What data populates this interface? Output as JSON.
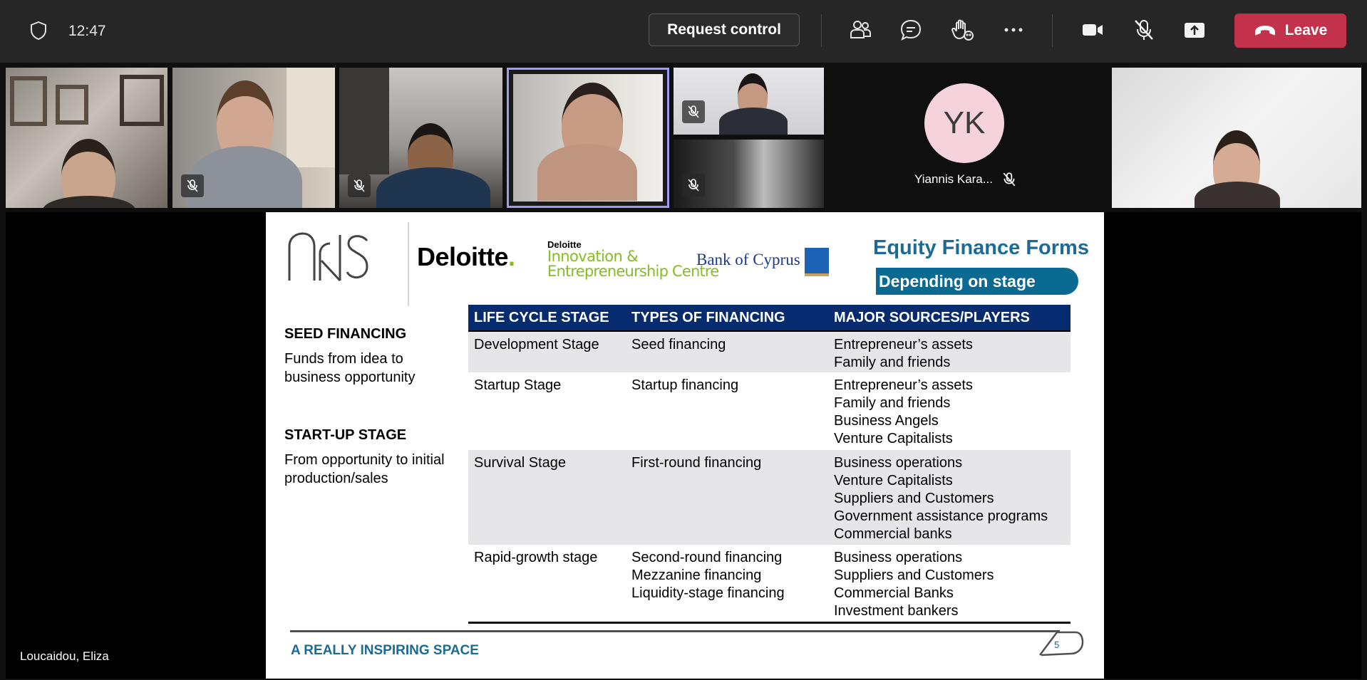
{
  "topbar": {
    "time": "12:47",
    "request_control_label": "Request control",
    "leave_label": "Leave",
    "icons": [
      "shield-icon",
      "people-icon",
      "chat-icon",
      "raise-hand-icon",
      "more-icon",
      "camera-icon",
      "mic-off-icon",
      "share-icon",
      "phone-hangup-icon"
    ]
  },
  "participants": {
    "yk_initials": "YK",
    "yk_name": "Yiannis Kara..."
  },
  "stage": {
    "presenter_name": "Loucaidou, Eliza"
  },
  "slide": {
    "logos": {
      "deloitte": "Deloitte",
      "deloitte_dot": ".",
      "dic_line1": "Deloitte",
      "dic_line2": "Innovation &",
      "dic_line3": "Entrepreneurship Centre",
      "bank": "Bank of Cyprus"
    },
    "title": "Equity Finance Forms",
    "subtitle": "Depending on stage",
    "left": {
      "seed_heading": "SEED FINANCING",
      "seed_text_1": "Funds from idea to",
      "seed_text_2": "business opportunity",
      "startup_heading": "START-UP STAGE",
      "startup_text_1": "From opportunity to initial",
      "startup_text_2": "production/sales"
    },
    "table": {
      "headers": [
        "LIFE CYCLE STAGE",
        "TYPES OF FINANCING",
        "MAJOR SOURCES/PLAYERS"
      ],
      "rows": [
        {
          "stage": "Development Stage",
          "financing": "Seed financing",
          "sources": "Entrepreneur’s assets\nFamily and friends"
        },
        {
          "stage": "Startup Stage",
          "financing": "Startup financing",
          "sources": "Entrepreneur’s assets\nFamily and friends\nBusiness Angels\nVenture Capitalists"
        },
        {
          "stage": "Survival Stage",
          "financing": "First-round financing",
          "sources": "Business operations\nVenture Capitalists\nSuppliers and Customers\nGovernment assistance programs\nCommercial banks"
        },
        {
          "stage": "Rapid-growth stage",
          "financing": "Second-round financing\nMezzanine financing\nLiquidity-stage financing",
          "sources": "Business operations\nSuppliers and Customers\nCommercial Banks\nInvestment bankers"
        }
      ]
    },
    "footer": "A REALLY INSPIRING SPACE",
    "page_number": "5"
  },
  "colors": {
    "leave_red": "#c4314b",
    "table_header": "#072b6f",
    "title_blue": "#1d6a94",
    "selected_tile_border": "#9c9cf0"
  }
}
